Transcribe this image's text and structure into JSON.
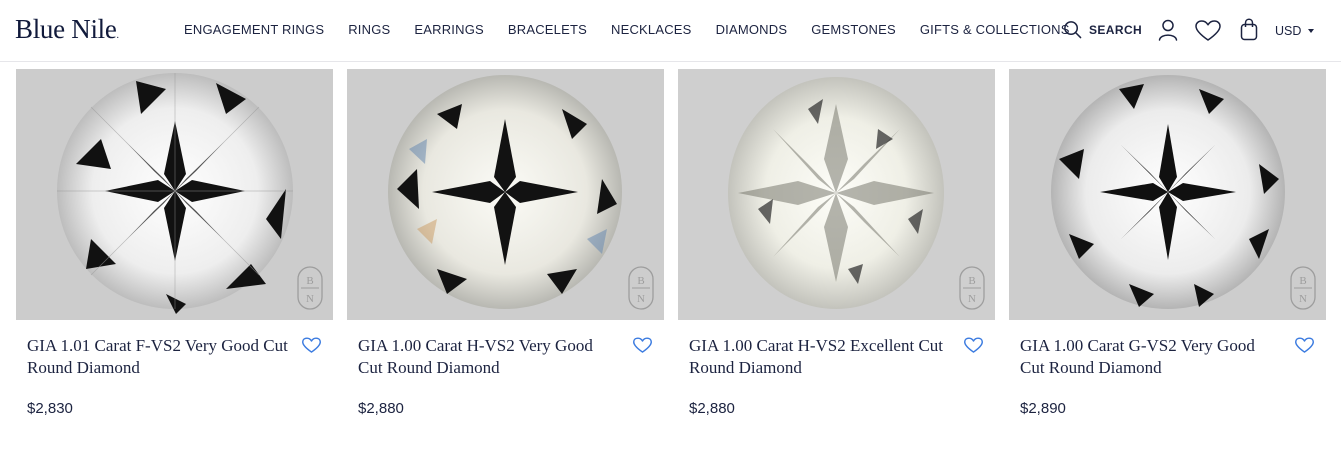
{
  "brand": {
    "logo_text": "Blue Nile"
  },
  "nav": {
    "items": [
      "ENGAGEMENT RINGS",
      "RINGS",
      "EARRINGS",
      "BRACELETS",
      "NECKLACES",
      "DIAMONDS",
      "GEMSTONES",
      "GIFTS & COLLECTIONS"
    ]
  },
  "utilities": {
    "search_label": "SEARCH",
    "currency": "USD",
    "icons": [
      "search-icon",
      "account-icon",
      "wishlist-icon",
      "bag-icon",
      "chevron-down-icon"
    ]
  },
  "products": [
    {
      "title": "GIA 1.01 Carat F-VS2 Very Good Cut Round Diamond",
      "price": "$2,830"
    },
    {
      "title": "GIA 1.00 Carat H-VS2 Very Good Cut Round Diamond",
      "price": "$2,880"
    },
    {
      "title": "GIA 1.00 Carat H-VS2 Excellent Cut Round Diamond",
      "price": "$2,880"
    },
    {
      "title": "GIA 1.00 Carat G-VS2 Very Good Cut Round Diamond",
      "price": "$2,890"
    }
  ],
  "watermark_text": "BN",
  "colors": {
    "text": "#1c2340",
    "heart": "#3b7be0",
    "image_bg": "#cfcfcf"
  }
}
